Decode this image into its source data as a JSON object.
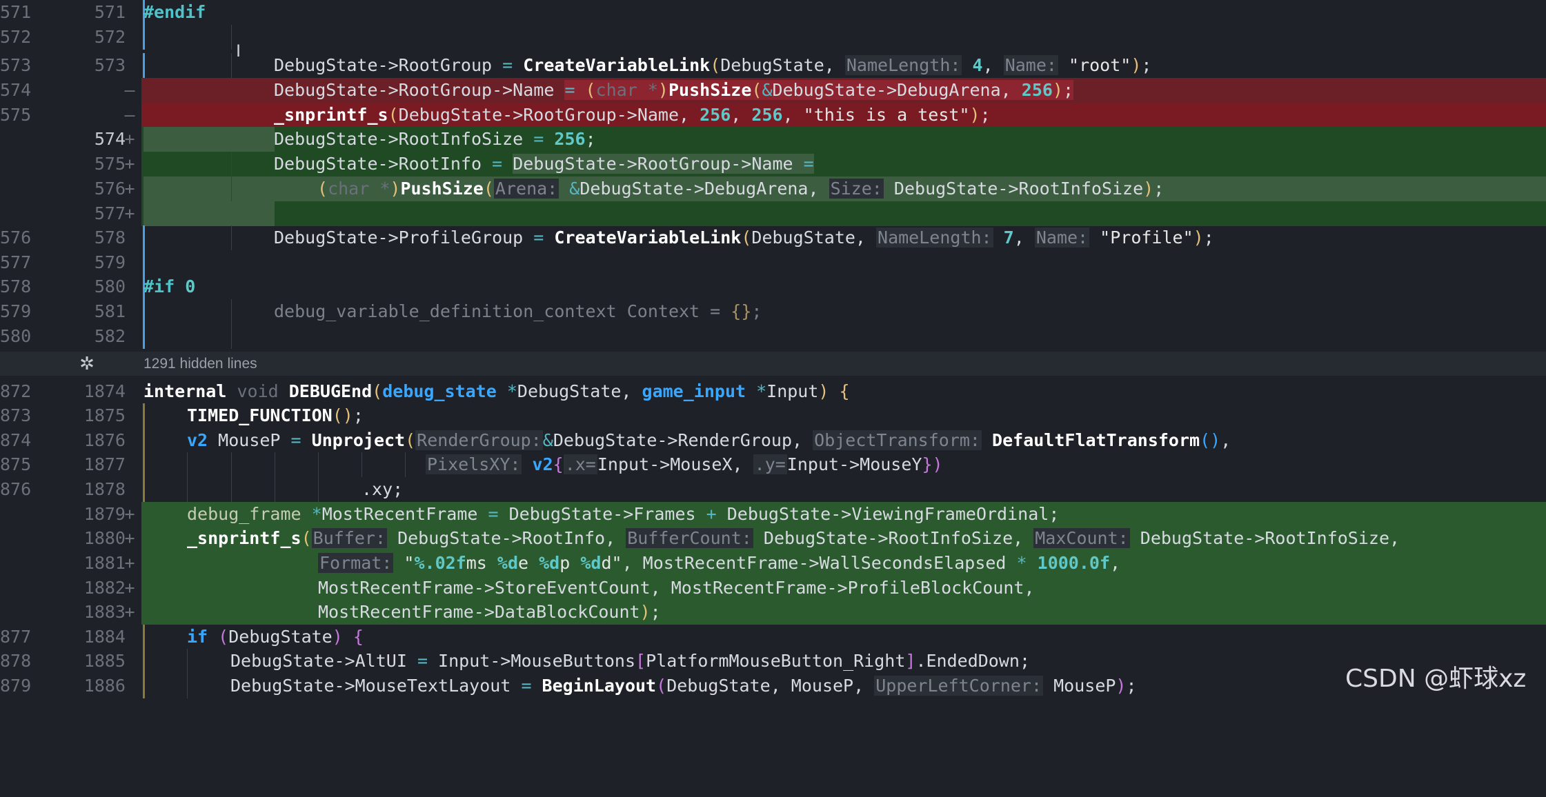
{
  "window": {
    "watermark": "CSDN @虾球xz"
  },
  "hidden_lines_label": "1291 hidden lines",
  "icons": {
    "unfold": "unfold-icon",
    "cursor": "text-cursor-icon"
  },
  "colors": {
    "removed_bg": "#6b2027",
    "added_bg": "#1f4a24",
    "editor_bg": "#1e2127",
    "change_bar": "#4aa0e6"
  },
  "lines": [
    {
      "old": "571",
      "new": "571",
      "sign": ""
    },
    {
      "old": "572",
      "new": "572",
      "sign": ""
    },
    {
      "old": "573",
      "new": "573",
      "sign": ""
    },
    {
      "old": "574",
      "new": "",
      "sign": "—"
    },
    {
      "old": "575",
      "new": "",
      "sign": "—"
    },
    {
      "old": "",
      "new": "574",
      "sign": "+"
    },
    {
      "old": "",
      "new": "575",
      "sign": "+"
    },
    {
      "old": "",
      "new": "576",
      "sign": "+"
    },
    {
      "old": "",
      "new": "577",
      "sign": "+"
    },
    {
      "old": "576",
      "new": "578",
      "sign": ""
    },
    {
      "old": "577",
      "new": "579",
      "sign": ""
    },
    {
      "old": "578",
      "new": "580",
      "sign": ""
    },
    {
      "old": "579",
      "new": "581",
      "sign": ""
    },
    {
      "old": "580",
      "new": "582",
      "sign": ""
    },
    {
      "old": "872",
      "new": "1874",
      "sign": ""
    },
    {
      "old": "873",
      "new": "1875",
      "sign": ""
    },
    {
      "old": "874",
      "new": "1876",
      "sign": ""
    },
    {
      "old": "875",
      "new": "1877",
      "sign": ""
    },
    {
      "old": "876",
      "new": "1878",
      "sign": ""
    },
    {
      "old": "",
      "new": "1879",
      "sign": "+"
    },
    {
      "old": "",
      "new": "1880",
      "sign": "+"
    },
    {
      "old": "",
      "new": "1881",
      "sign": "+"
    },
    {
      "old": "",
      "new": "1882",
      "sign": "+"
    },
    {
      "old": "",
      "new": "1883",
      "sign": "+"
    },
    {
      "old": "877",
      "new": "1884",
      "sign": ""
    },
    {
      "old": "878",
      "new": "1885",
      "sign": ""
    },
    {
      "old": "879",
      "new": "1886",
      "sign": ""
    }
  ],
  "code": {
    "l571": "#endif",
    "l573": {
      "a": "DebugState->RootGroup ",
      "eq": "= ",
      "fn": "CreateVariableLink",
      "p1": "(",
      "b": "DebugState, ",
      "h1": "NameLength:",
      "n1": "4",
      "c": ", ",
      "h2": "Name:",
      "s": "\"root\"",
      "p2": ")",
      "e": ";"
    },
    "l574": {
      "a": "DebugState->RootGroup->Name ",
      "eq": "= ",
      "p1": "(",
      "t": "char *",
      "p2": ")",
      "fn": "PushSize",
      "p3": "(",
      "amp": "&",
      "b": "DebugState->DebugArena, ",
      "n": "256",
      "p4": ")",
      "e": ";"
    },
    "l575": {
      "fn": "_snprintf_s",
      "p1": "(",
      "a": "DebugState->RootGroup->Name, ",
      "n1": "256",
      "c1": ", ",
      "n2": "256",
      "c2": ", ",
      "s": "\"this is a test\"",
      "p2": ")",
      "e": ";"
    },
    "n574": {
      "a": "DebugState->RootInfoSize ",
      "eq": "= ",
      "n": "256",
      "e": ";"
    },
    "n575": {
      "a": "DebugState->RootInfo ",
      "eq": "= ",
      "b": "DebugState->RootGroup->Name ",
      "eq2": "="
    },
    "n576": {
      "p1": "(",
      "t": "char *",
      "p2": ")",
      "fn": "PushSize",
      "p3": "(",
      "h1": "Arena:",
      "amp": "&",
      "a": "DebugState->DebugArena, ",
      "h2": "Size:",
      "b": "DebugState->RootInfoSize",
      "p4": ")",
      "e": ";"
    },
    "l578": {
      "a": "DebugState->ProfileGroup ",
      "eq": "= ",
      "fn": "CreateVariableLink",
      "p1": "(",
      "b": "DebugState, ",
      "h1": "NameLength:",
      "n1": "7",
      "c": ", ",
      "h2": "Name:",
      "s": "\"Profile\"",
      "p2": ")",
      "e": ";"
    },
    "l580": {
      "k": "#if ",
      "n": "0"
    },
    "l581": {
      "a": "debug_variable_definition_context Context ",
      "eq": "= ",
      "br": "{}",
      "e": ";"
    },
    "l1874": {
      "k": "internal ",
      "v": "void ",
      "fn": "DEBUGEnd",
      "p1": "(",
      "t1": "debug_state",
      "st1": " *",
      "a": "DebugState, ",
      "t2": "game_input",
      "st2": " *",
      "b": "Input",
      "p2": ")",
      "br": " {"
    },
    "l1875": {
      "fn": "TIMED_FUNCTION",
      "p": "()",
      "e": ";"
    },
    "l1876": {
      "t": "v2",
      "a": " MouseP ",
      "eq": "= ",
      "fn": "Unproject",
      "p1": "(",
      "h1": "RenderGroup:",
      "amp": "&",
      "b": "DebugState->RenderGroup, ",
      "h2": "ObjectTransform:",
      "fn2": "DefaultFlatTransform",
      "p2": "()",
      "e": ","
    },
    "l1877": {
      "h": "PixelsXY:",
      "t": "v2",
      "br1": "{",
      "d1": ".x=",
      "a": "Input->MouseX, ",
      "d2": ".y=",
      "b": "Input->MouseY",
      "br2": "}",
      "p": ")"
    },
    "l1878": {
      "a": ".xy",
      "e": ";"
    },
    "l1879": {
      "a": "debug_frame ",
      "st": "*",
      "b": "MostRecentFrame ",
      "eq": "= ",
      "c": "DebugState->Frames ",
      "pl": "+ ",
      "d": "DebugState->ViewingFrameOrdinal",
      "e": ";"
    },
    "l1880": {
      "fn": "_snprintf_s",
      "p1": "(",
      "h1": "Buffer:",
      "a": "DebugState->RootInfo, ",
      "h2": "BufferCount:",
      "b": "DebugState->RootInfoSize, ",
      "h3": "MaxCount:",
      "c": "DebugState->RootInfoSize,"
    },
    "l1881": {
      "h": "Format:",
      "s1": "\"",
      "f1": "%.02f",
      "s2": "ms ",
      "f2": "%d",
      "s3": "e ",
      "f3": "%d",
      "s4": "p ",
      "f4": "%d",
      "s5": "d\"",
      "c": ", ",
      "a": "MostRecentFrame->WallSecondsElapsed ",
      "mul": "* ",
      "n": "1000.0f",
      "e": ","
    },
    "l1882": {
      "a": "MostRecentFrame->StoreEventCount, MostRecentFrame->ProfileBlockCount,"
    },
    "l1883": {
      "a": "MostRecentFrame->DataBlockCount",
      "p": ")",
      "e": ";"
    },
    "l1884": {
      "k": "if ",
      "p1": "(",
      "a": "DebugState",
      "p2": ")",
      "br": " {"
    },
    "l1885": {
      "a": "DebugState->AltUI ",
      "eq": "= ",
      "b": "Input->MouseButtons",
      "br1": "[",
      "c": "PlatformMouseButton_Right",
      "br2": "]",
      "d": ".EndedDown",
      "e": ";"
    },
    "l1886": {
      "a": "DebugState->MouseTextLayout ",
      "eq": "= ",
      "fn": "BeginLayout",
      "p1": "(",
      "b": "DebugState, MouseP, ",
      "h": "UpperLeftCorner:",
      "c": "MouseP",
      "p2": ")",
      "e": ";"
    }
  }
}
